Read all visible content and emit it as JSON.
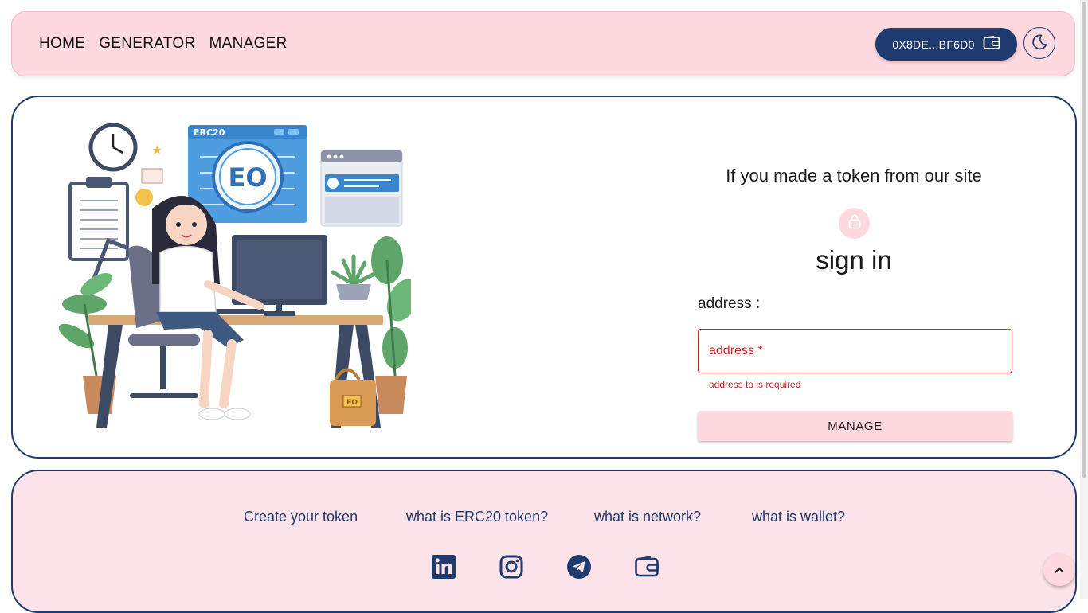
{
  "nav": {
    "items": [
      {
        "label": "HOME"
      },
      {
        "label": "GENERATOR"
      },
      {
        "label": "MANAGER"
      }
    ]
  },
  "wallet": {
    "address_short": "0X8DE...BF6D0",
    "icon": "wallet-icon"
  },
  "theme_toggle": {
    "icon": "moon-icon"
  },
  "illustration": {
    "panel_label": "ERC20",
    "badge_text": "EO",
    "bag_text": "EO"
  },
  "form": {
    "subtitle": "If you made a token from our site",
    "lock_icon": "lock-icon",
    "title": "sign in",
    "field_label": "address :",
    "input_placeholder": "address *",
    "input_value": "",
    "helper_text": "address to is required",
    "submit_label": "MANAGE"
  },
  "footer": {
    "links": [
      {
        "label": "Create your token"
      },
      {
        "label": "what is ERC20 token?"
      },
      {
        "label": "what is network?"
      },
      {
        "label": "what is wallet?"
      }
    ],
    "socials": [
      {
        "icon": "linkedin-icon"
      },
      {
        "icon": "instagram-icon"
      },
      {
        "icon": "telegram-icon"
      },
      {
        "icon": "wallet-icon"
      }
    ]
  },
  "colors": {
    "primary_navy": "#1e3a6e",
    "pink_bg": "#ffd9e0",
    "footer_bg": "#fde4ea",
    "error_red": "#c62828"
  }
}
